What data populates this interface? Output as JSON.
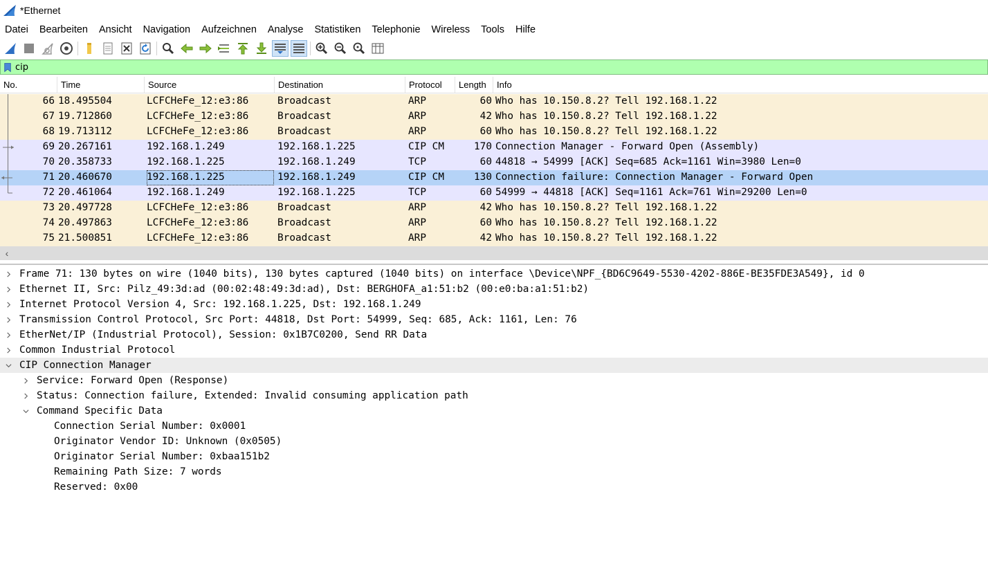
{
  "window": {
    "title": "*Ethernet"
  },
  "menu": [
    "Datei",
    "Bearbeiten",
    "Ansicht",
    "Navigation",
    "Aufzeichnen",
    "Analyse",
    "Statistiken",
    "Telephonie",
    "Wireless",
    "Tools",
    "Hilfe"
  ],
  "toolbar": {
    "icons": [
      "shark-fin-start-icon",
      "stop-square-icon",
      "restart-fin-icon",
      "capture-options-gear-icon",
      "open-folder-icon",
      "save-file-icon",
      "close-file-icon",
      "reload-file-icon",
      "find-packet-magnifier-icon",
      "go-back-arrow-icon",
      "go-forward-arrow-icon",
      "go-to-packet-icon",
      "first-packet-icon",
      "last-packet-icon",
      "auto-scroll-icon",
      "colorize-icon",
      "zoom-in-icon",
      "zoom-out-icon",
      "normal-size-icon",
      "resize-columns-icon"
    ]
  },
  "filter": {
    "value": "cip"
  },
  "columns": {
    "no": "No.",
    "time": "Time",
    "source": "Source",
    "destination": "Destination",
    "protocol": "Protocol",
    "length": "Length",
    "info": "Info"
  },
  "packets": [
    {
      "no": "66",
      "time": "18.495504",
      "source": "LCFCHeFe_12:e3:86",
      "destination": "Broadcast",
      "protocol": "ARP",
      "length": "60",
      "info": "Who has 10.150.8.2? Tell 192.168.1.22"
    },
    {
      "no": "67",
      "time": "19.712860",
      "source": "LCFCHeFe_12:e3:86",
      "destination": "Broadcast",
      "protocol": "ARP",
      "length": "42",
      "info": "Who has 10.150.8.2? Tell 192.168.1.22"
    },
    {
      "no": "68",
      "time": "19.713112",
      "source": "LCFCHeFe_12:e3:86",
      "destination": "Broadcast",
      "protocol": "ARP",
      "length": "60",
      "info": "Who has 10.150.8.2? Tell 192.168.1.22"
    },
    {
      "no": "69",
      "time": "20.267161",
      "source": "192.168.1.249",
      "destination": "192.168.1.225",
      "protocol": "CIP CM",
      "length": "170",
      "info": "Connection Manager - Forward Open (Assembly)"
    },
    {
      "no": "70",
      "time": "20.358733",
      "source": "192.168.1.225",
      "destination": "192.168.1.249",
      "protocol": "TCP",
      "length": "60",
      "info": "44818 → 54999 [ACK] Seq=685 Ack=1161 Win=3980 Len=0"
    },
    {
      "no": "71",
      "time": "20.460670",
      "source": "192.168.1.225",
      "destination": "192.168.1.249",
      "protocol": "CIP CM",
      "length": "130",
      "info": "Connection failure: Connection Manager - Forward Open"
    },
    {
      "no": "72",
      "time": "20.461064",
      "source": "192.168.1.249",
      "destination": "192.168.1.225",
      "protocol": "TCP",
      "length": "60",
      "info": "54999 → 44818 [ACK] Seq=1161 Ack=761 Win=29200 Len=0"
    },
    {
      "no": "73",
      "time": "20.497728",
      "source": "LCFCHeFe_12:e3:86",
      "destination": "Broadcast",
      "protocol": "ARP",
      "length": "42",
      "info": "Who has 10.150.8.2? Tell 192.168.1.22"
    },
    {
      "no": "74",
      "time": "20.497863",
      "source": "LCFCHeFe_12:e3:86",
      "destination": "Broadcast",
      "protocol": "ARP",
      "length": "60",
      "info": "Who has 10.150.8.2? Tell 192.168.1.22"
    },
    {
      "no": "75",
      "time": "21.500851",
      "source": "LCFCHeFe_12:e3:86",
      "destination": "Broadcast",
      "protocol": "ARP",
      "length": "42",
      "info": "Who has 10.150.8.2? Tell 192.168.1.22"
    }
  ],
  "selected_packet": "71",
  "colors": {
    "arp_row": "#faf0d7",
    "cip_row": "#e7e6ff",
    "selected_row": "#b5d3f7",
    "filter_valid": "#afffaf"
  },
  "details": [
    {
      "text": "Frame 71: 130 bytes on wire (1040 bits), 130 bytes captured (1040 bits) on interface \\Device\\NPF_{BD6C9649-5530-4202-886E-BE35FDE3A549}, id 0",
      "level": 0,
      "state": "collapsed"
    },
    {
      "text": "Ethernet II, Src: Pilz_49:3d:ad (00:02:48:49:3d:ad), Dst: BERGHOFA_a1:51:b2 (00:e0:ba:a1:51:b2)",
      "level": 0,
      "state": "collapsed"
    },
    {
      "text": "Internet Protocol Version 4, Src: 192.168.1.225, Dst: 192.168.1.249",
      "level": 0,
      "state": "collapsed"
    },
    {
      "text": "Transmission Control Protocol, Src Port: 44818, Dst Port: 54999, Seq: 685, Ack: 1161, Len: 76",
      "level": 0,
      "state": "collapsed"
    },
    {
      "text": "EtherNet/IP (Industrial Protocol), Session: 0x1B7C0200, Send RR Data",
      "level": 0,
      "state": "collapsed"
    },
    {
      "text": "Common Industrial Protocol",
      "level": 0,
      "state": "collapsed"
    },
    {
      "text": "CIP Connection Manager",
      "level": 0,
      "state": "expanded"
    },
    {
      "text": "Service: Forward Open (Response)",
      "level": 1,
      "state": "collapsed"
    },
    {
      "text": "Status: Connection failure, Extended: Invalid consuming application path",
      "level": 1,
      "state": "collapsed"
    },
    {
      "text": "Command Specific Data",
      "level": 1,
      "state": "expanded"
    },
    {
      "text": "Connection Serial Number: 0x0001",
      "level": 2,
      "state": "leaf"
    },
    {
      "text": "Originator Vendor ID: Unknown (0x0505)",
      "level": 2,
      "state": "leaf"
    },
    {
      "text": "Originator Serial Number: 0xbaa151b2",
      "level": 2,
      "state": "leaf"
    },
    {
      "text": "Remaining Path Size: 7 words",
      "level": 2,
      "state": "leaf"
    },
    {
      "text": "Reserved: 0x00",
      "level": 2,
      "state": "leaf"
    }
  ]
}
